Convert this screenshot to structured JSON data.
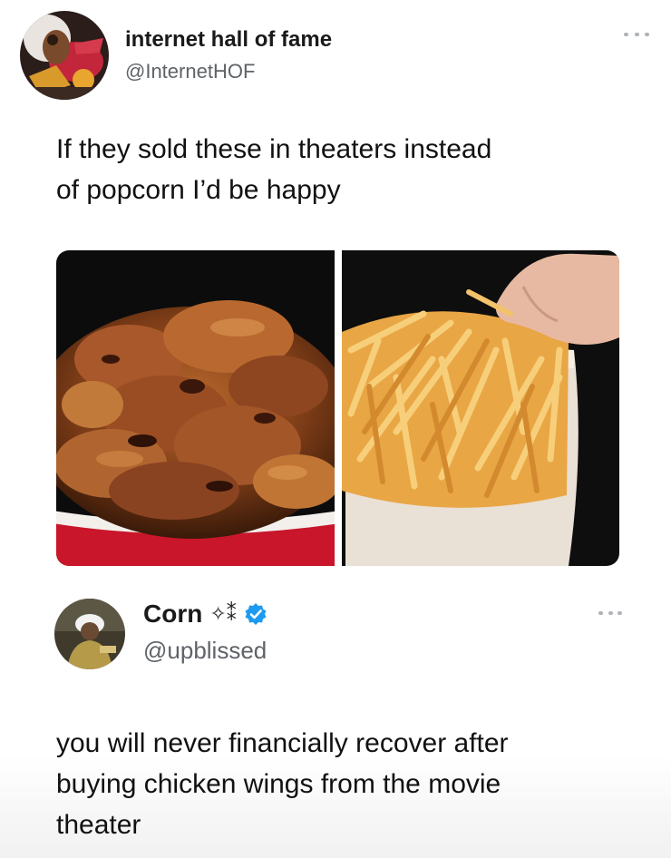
{
  "original_tweet": {
    "display_name": "internet hall of fame",
    "handle": "@InternetHOF",
    "text": "If they sold these in theaters instead\nof popcorn I’d be happy",
    "more_icon": "more-horizontal-icon",
    "images": [
      {
        "subject": "chicken-wings-bucket"
      },
      {
        "subject": "french-fries-cup"
      }
    ]
  },
  "reply_tweet": {
    "display_name": "Corn",
    "name_symbols": "✧⁑",
    "verified_icon": "verified-badge-icon",
    "verified_color": "#1d9bf0",
    "handle": "@upblissed",
    "text": "you will never financially recover after\nbuying chicken wings from the movie\ntheater",
    "more_icon": "more-horizontal-icon"
  }
}
